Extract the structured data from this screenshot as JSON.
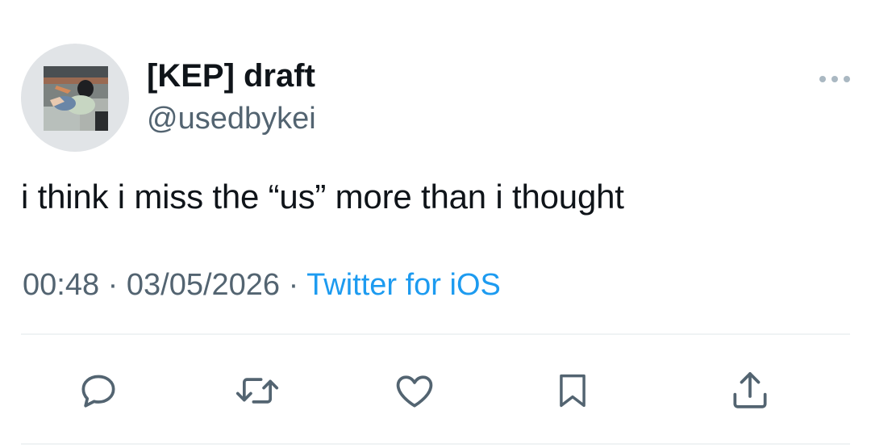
{
  "tweet": {
    "display_name": "[KEP] draft",
    "handle": "@usedbykei",
    "text": "i think i miss the “us” more than i thought",
    "time": "00:48",
    "separator": "·",
    "date": "03/05/2026",
    "source": "Twitter for iOS"
  },
  "actions": [
    {
      "name": "reply",
      "icon": "reply-icon"
    },
    {
      "name": "retweet",
      "icon": "retweet-icon"
    },
    {
      "name": "like",
      "icon": "heart-icon"
    },
    {
      "name": "bookmark",
      "icon": "bookmark-icon"
    },
    {
      "name": "share",
      "icon": "share-icon"
    }
  ],
  "colors": {
    "text_primary": "#0f1419",
    "text_secondary": "#536471",
    "link": "#1d9bf0",
    "divider": "#eff3f4",
    "icon": "#536471",
    "more_dots": "#aab8c2"
  }
}
